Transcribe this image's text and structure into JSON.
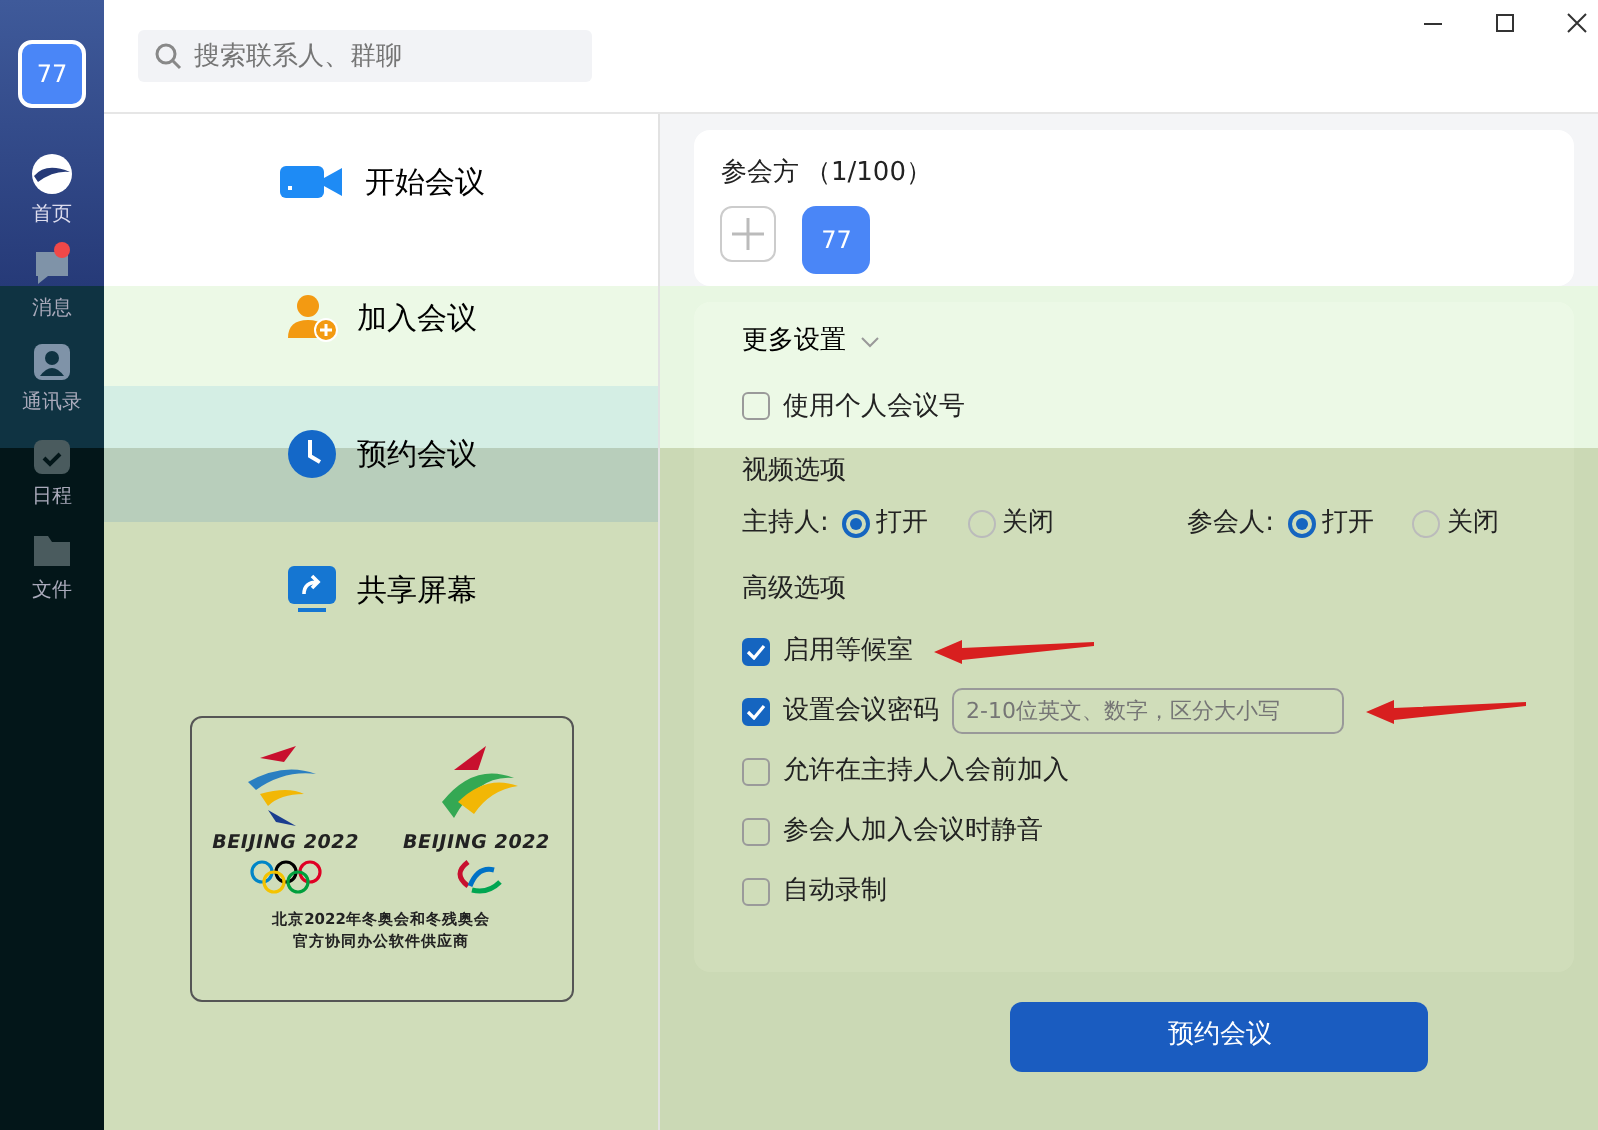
{
  "user": {
    "avatar": "77"
  },
  "nav": [
    {
      "label": "首页",
      "selected": true,
      "unread": false
    },
    {
      "label": "消息",
      "selected": false,
      "unread": true
    },
    {
      "label": "通讯录",
      "selected": false,
      "unread": false
    },
    {
      "label": "日程",
      "selected": false,
      "unread": false
    },
    {
      "label": "文件",
      "selected": false,
      "unread": false
    }
  ],
  "search": {
    "placeholder": "搜索联系人、群聊"
  },
  "actions": [
    {
      "label": "开始会议",
      "selected": false
    },
    {
      "label": "加入会议",
      "selected": false
    },
    {
      "label": "预约会议",
      "selected": true
    },
    {
      "label": "共享屏幕",
      "selected": false
    }
  ],
  "sponsor": {
    "logos": [
      {
        "text": "BEIJING 2022",
        "kind": "olympic"
      },
      {
        "text": "BEIJING 2022",
        "kind": "paralympic"
      }
    ],
    "lines": [
      "北京2022年冬奥会和冬残奥会",
      "官方协同办公软件供应商"
    ]
  },
  "participants": {
    "title": "参会方",
    "count": "（1/100）",
    "members": [
      {
        "avatar": "77"
      }
    ]
  },
  "settings": {
    "title": "更多设置",
    "expanded": true,
    "personal_id": {
      "label": "使用个人会议号",
      "checked": false
    },
    "video": {
      "title": "视频选项",
      "groups": [
        {
          "label": "主持人:",
          "options": [
            {
              "label": "打开",
              "selected": true
            },
            {
              "label": "关闭",
              "selected": false
            }
          ]
        },
        {
          "label": "参会人:",
          "options": [
            {
              "label": "打开",
              "selected": true
            },
            {
              "label": "关闭",
              "selected": false
            }
          ]
        }
      ]
    },
    "advanced": {
      "title": "高级选项",
      "items": [
        {
          "label": "启用等候室",
          "checked": true,
          "arrow": true
        },
        {
          "label": "设置会议密码",
          "checked": true,
          "arrow": true,
          "placeholder": "2-10位英文、数字，区分大小写"
        },
        {
          "label": "允许在主持人入会前加入",
          "checked": false,
          "arrow": false
        },
        {
          "label": "参会人加入会议时静音",
          "checked": false,
          "arrow": false
        },
        {
          "label": "自动录制",
          "checked": false,
          "arrow": false
        }
      ]
    }
  },
  "submit": "预约会议"
}
